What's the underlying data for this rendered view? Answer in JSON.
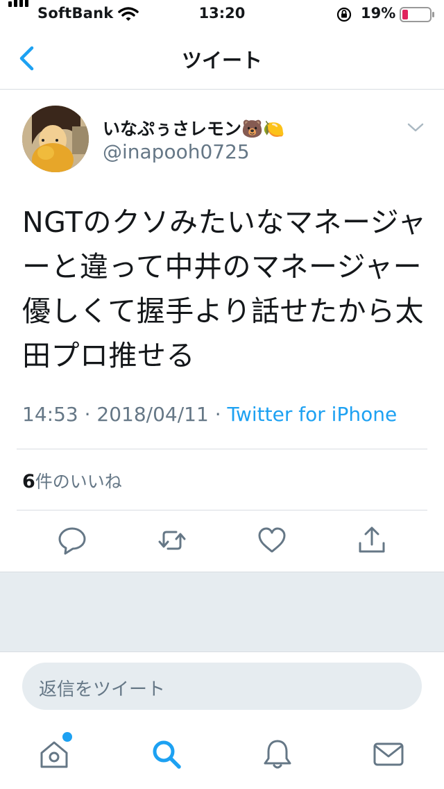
{
  "status_bar": {
    "carrier": "SoftBank",
    "time": "13:20",
    "battery": "19%"
  },
  "nav": {
    "title": "ツイート"
  },
  "tweet": {
    "display_name": "いなぷぅさレモン🐻🍋",
    "handle": "@inapooh0725",
    "text": "NGTのクソみたいなマネージャーと違って中井のマネージャー優しくて握手より話せたから太田プロ推せる",
    "time": "14:53",
    "separator": "·",
    "date": "2018/04/11",
    "source": "Twitter for iPhone",
    "likes_count": "6",
    "likes_label": "件のいいね"
  },
  "reply": {
    "placeholder": "返信をツイート"
  },
  "colors": {
    "accent": "#1da1f2",
    "muted": "#657786",
    "divider": "#d8dde2",
    "band": "#e6ecf0",
    "battery_low": "#e0245e"
  },
  "icons": {
    "actions": [
      "reply-icon",
      "retweet-icon",
      "like-icon",
      "share-icon"
    ],
    "tabs": [
      "home-icon",
      "search-icon",
      "notifications-icon",
      "messages-icon"
    ]
  }
}
